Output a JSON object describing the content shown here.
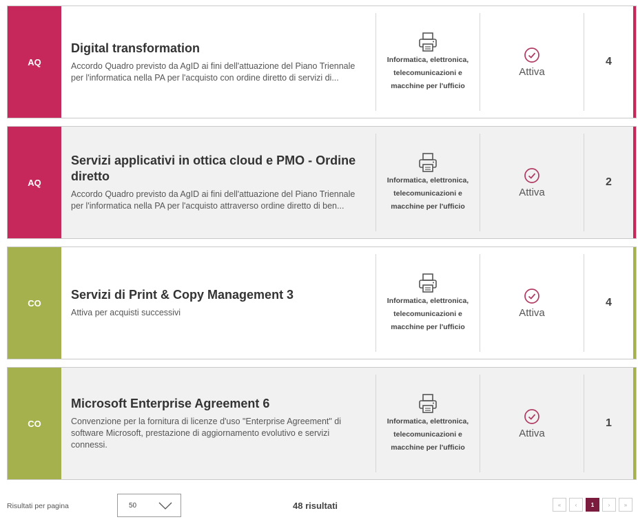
{
  "colors": {
    "aq": "#c7285c",
    "co": "#a5b14d",
    "active_page": "#7b1b3e",
    "check": "#b03a63"
  },
  "items": [
    {
      "badge": "AQ",
      "title": "Digital transformation",
      "description": "Accordo Quadro previsto da AgID ai fini dell'attuazione del Piano Triennale per l'informatica nella PA per l'acquisto con ordine diretto di servizi di...",
      "category_icon": "printer-icon",
      "category": "Informatica, elettronica, telecomunicazioni e macchine per l'ufficio",
      "status_icon": "check-circle-icon",
      "status": "Attiva",
      "count": "4"
    },
    {
      "badge": "AQ",
      "title": "Servizi applicativi in ottica cloud e PMO - Ordine diretto",
      "description": "Accordo Quadro previsto da AgID ai fini dell'attuazione del Piano Triennale per l'informatica nella PA per l'acquisto attraverso ordine diretto di ben...",
      "category_icon": "printer-icon",
      "category": "Informatica, elettronica, telecomunicazioni e macchine per l'ufficio",
      "status_icon": "check-circle-icon",
      "status": "Attiva",
      "count": "2"
    },
    {
      "badge": "CO",
      "title": "Servizi di Print & Copy Management 3",
      "description": "Attiva per acquisti successivi",
      "category_icon": "printer-icon",
      "category": "Informatica, elettronica, telecomunicazioni e macchine per l'ufficio",
      "status_icon": "check-circle-icon",
      "status": "Attiva",
      "count": "4"
    },
    {
      "badge": "CO",
      "title": "Microsoft Enterprise Agreement 6",
      "description": "Convenzione per la fornitura di licenze d'uso \"Enterprise Agreement\" di software Microsoft, prestazione di aggiornamento evolutivo e servizi connessi.",
      "category_icon": "printer-icon",
      "category": "Informatica, elettronica, telecomunicazioni e macchine per l'ufficio",
      "status_icon": "check-circle-icon",
      "status": "Attiva",
      "count": "1"
    }
  ],
  "footer": {
    "results_per_page_label": "Risultati per pagina",
    "results_per_page_value": "50",
    "results_count": "48 risultati",
    "pagination": {
      "first": "«",
      "prev": "‹",
      "current": "1",
      "next": "›",
      "last": "»"
    }
  }
}
